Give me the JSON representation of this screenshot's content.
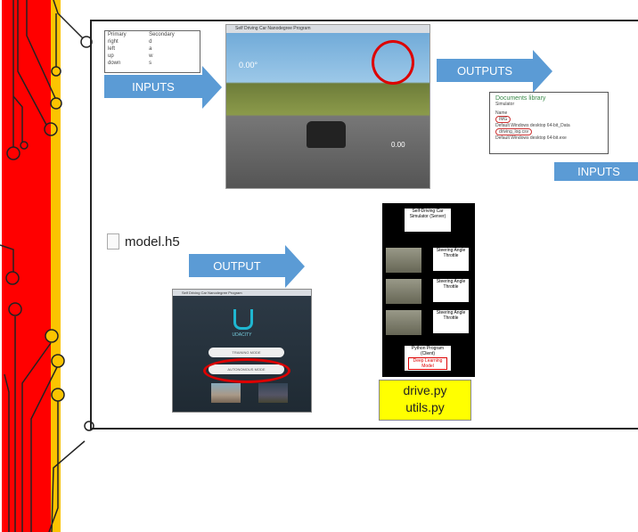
{
  "key_table": {
    "headers": [
      "Primary",
      "Secondary"
    ],
    "rows": [
      [
        "right",
        "d"
      ],
      [
        "left",
        "a"
      ],
      [
        "up",
        "w"
      ],
      [
        "down",
        "s"
      ]
    ]
  },
  "arrows": {
    "inputs_top": "INPUTS",
    "outputs": "OUTPUTS",
    "inputs_right": "INPUTS",
    "output": "OUTPUT"
  },
  "simulator": {
    "title": "Self Driving Car Nanodegree Program",
    "angle": "0.00°",
    "speed": "0.00"
  },
  "docs": {
    "title": "Documents library",
    "subtitle": "Simulator",
    "column": "Name",
    "items": [
      "IMG",
      "Default Windows desktop 64-bit_Data",
      "driving_log.csv",
      "Default Windows desktop 64-bit.exe"
    ]
  },
  "model_file": "model.h5",
  "menu": {
    "title": "Self Driving Car Nanodegree Program",
    "logo": "UDACITY",
    "training": "TRAINING MODE",
    "autonomous": "AUTONOMOUS MODE"
  },
  "diagram": {
    "server": "Self-Driving Car Simulator (Server)",
    "client": "Python Program (Client)",
    "model": "Deep Learning Model",
    "steering": "Steering Angle",
    "throttle": "Throttle"
  },
  "scripts": [
    "drive.py",
    "utils.py"
  ]
}
